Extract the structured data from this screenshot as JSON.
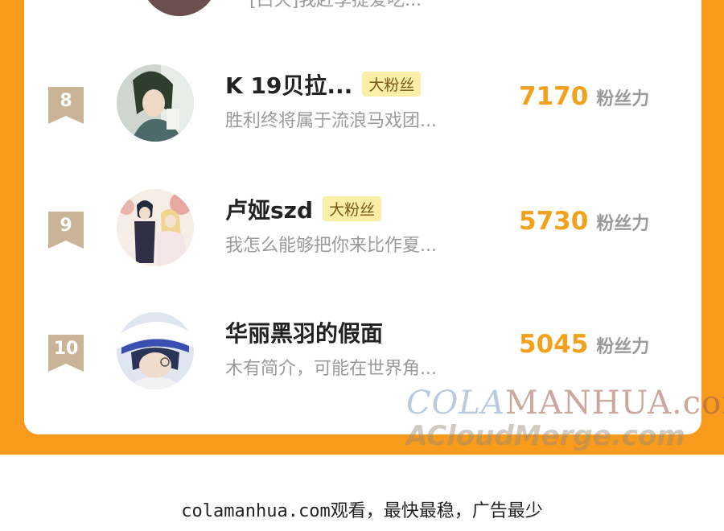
{
  "partial_row": {
    "bio": "[白天]我赶季提爱吃..."
  },
  "rows": [
    {
      "rank": "8",
      "name": "K  19贝拉...",
      "badge": "大粉丝",
      "bio": "胜利终将属于流浪马戏团...",
      "fans": "7170",
      "fans_label": "粉丝力"
    },
    {
      "rank": "9",
      "name": "卢娅szd",
      "badge": "大粉丝",
      "bio": "我怎么能够把你来比作夏...",
      "fans": "5730",
      "fans_label": "粉丝力"
    },
    {
      "rank": "10",
      "name": "华丽黑羽的假面",
      "badge": "",
      "bio": "木有简介，可能在世界角...",
      "fans": "5045",
      "fans_label": "粉丝力"
    }
  ],
  "watermark": {
    "line1_a": "COLA",
    "line1_b": "MANHUA.com",
    "line2": "ACloudMerge.com"
  },
  "footer": {
    "text": "colamanhua.com观看，最快最稳，广告最少"
  },
  "colors": {
    "frame": "#f89a1c",
    "fans": "#f0a21c",
    "badge_bg": "#fbeea6",
    "rank_tag": "#c9b497"
  }
}
